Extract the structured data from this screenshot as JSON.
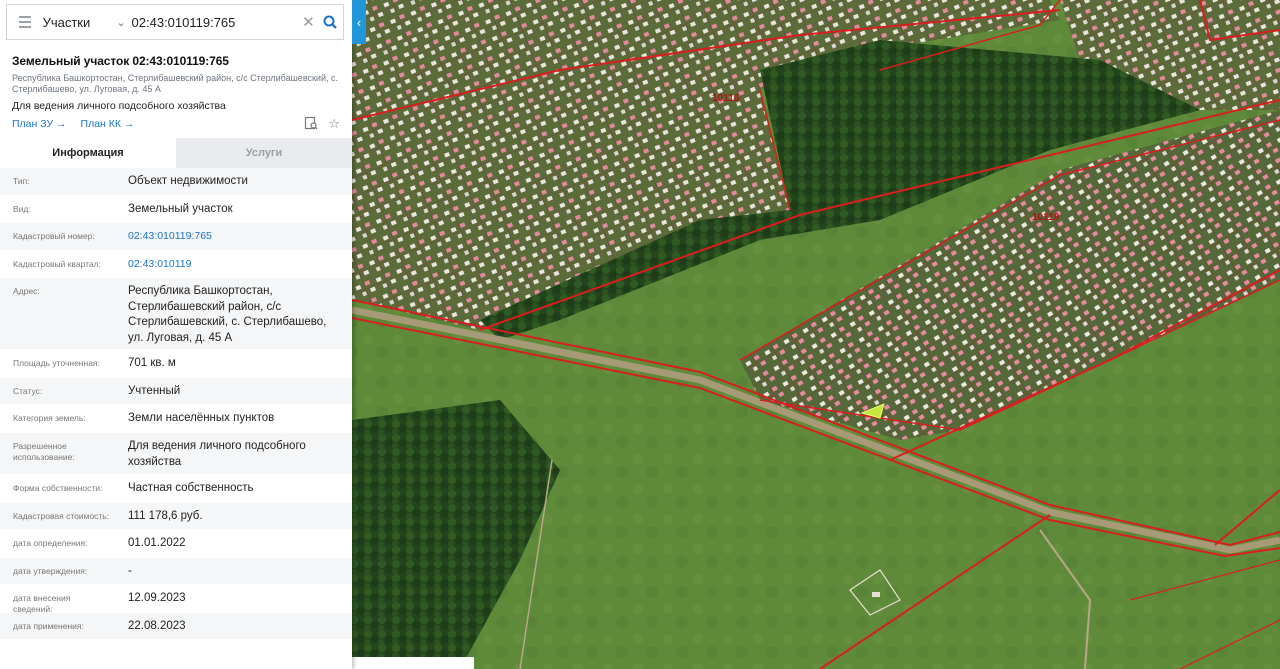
{
  "search": {
    "type_label": "Участки",
    "query": "02:43:010119:765"
  },
  "parcel": {
    "title": "Земельный участок 02:43:010119:765",
    "address_short": "Республика Башкортостан, Стерлибашевский район, с/с Стерлибашевский, с. Стерлибашево, ул. Луговая, д. 45 А",
    "purpose": "Для ведения личного подсобного хозяйства",
    "link_plan_zu": "План ЗУ →",
    "link_plan_kk": "План КК →"
  },
  "tabs": {
    "info": "Информация",
    "services": "Услуги"
  },
  "info_rows": [
    {
      "k": "Тип:",
      "v": "Объект недвижимости"
    },
    {
      "k": "Вид:",
      "v": "Земельный участок"
    },
    {
      "k": "Кадастровый номер:",
      "v": "02:43:010119:765"
    },
    {
      "k": "Кадастровый квартал:",
      "v": "02:43:010119"
    },
    {
      "k": "Адрес:",
      "v": "Республика Башкортостан, Стерлибашевский район, с/с Стерлибашевский, с. Стерлибашево, ул. Луговая, д. 45 А"
    },
    {
      "k": "Площадь уточненная:",
      "v": "701 кв. м"
    },
    {
      "k": "Статус:",
      "v": "Учтенный"
    },
    {
      "k": "Категория земель:",
      "v": "Земли населённых пунктов"
    },
    {
      "k": "Разрешенное использование:",
      "v": "Для ведения личного подсобного хозяйства"
    },
    {
      "k": "Форма собственности:",
      "v": "Частная собственность"
    },
    {
      "k": "Кадастровая стоимость:",
      "v": "111 178,6 руб."
    },
    {
      "k": "дата определения:",
      "v": "01.01.2022"
    },
    {
      "k": "дата утверждения:",
      "v": "-"
    },
    {
      "k": "дата внесения сведений:",
      "v": "12.09.2023"
    },
    {
      "k": "дата применения:",
      "v": "22.08.2023"
    }
  ],
  "map": {
    "quarter_labels": [
      "10116",
      "10119"
    ],
    "boundary_color": "#d81e1e",
    "selected_color": "#c8e63c"
  },
  "colors": {
    "accent": "#2196d8",
    "link": "#1a73c9"
  }
}
